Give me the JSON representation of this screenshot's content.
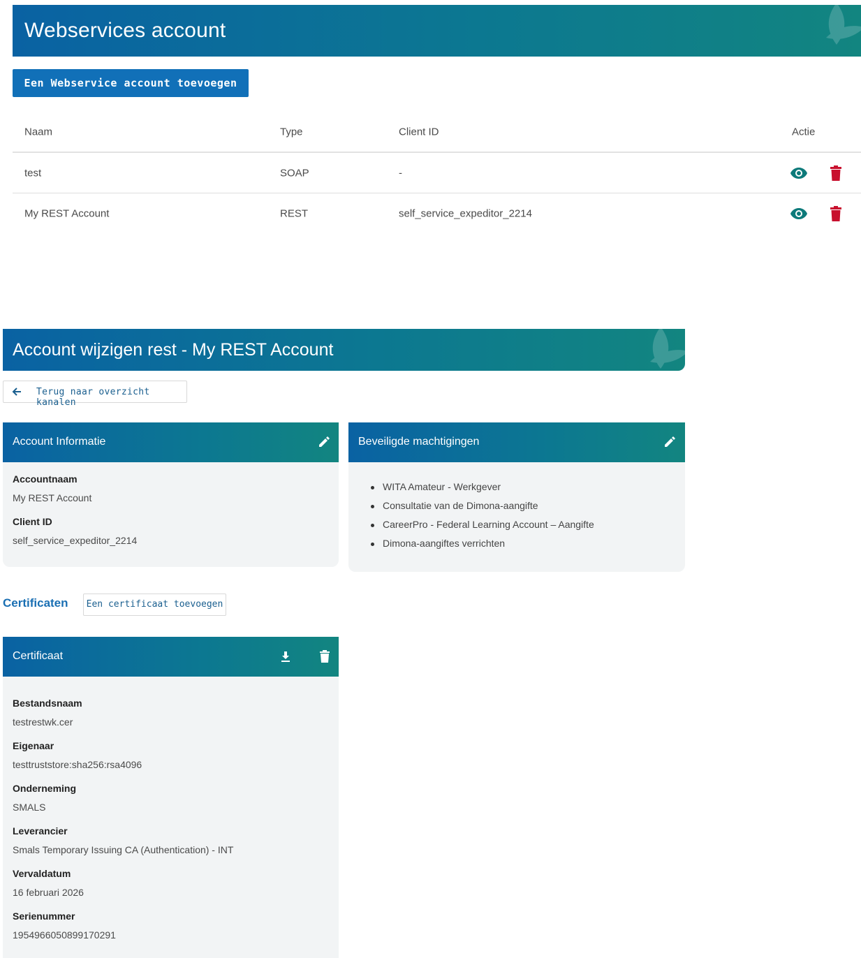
{
  "overview": {
    "title": "Webservices account",
    "add_button": "Een Webservice account toevoegen",
    "columns": {
      "naam": "Naam",
      "type": "Type",
      "client_id": "Client ID",
      "actie": "Actie"
    },
    "rows": [
      {
        "naam": "test",
        "type": "SOAP",
        "client_id": "-"
      },
      {
        "naam": "My REST Account",
        "type": "REST",
        "client_id": "self_service_expeditor_2214"
      }
    ],
    "icons": {
      "view": "eye-icon",
      "delete": "trash-icon"
    },
    "colors": {
      "view": "#0d7a7a",
      "delete": "#c8102e"
    }
  },
  "edit": {
    "title": "Account wijzigen rest - My REST Account",
    "back_button": "Terug naar overzicht kanalen",
    "account_info": {
      "title": "Account Informatie",
      "accountnaam_label": "Accountnaam",
      "accountnaam_value": "My REST Account",
      "client_id_label": "Client ID",
      "client_id_value": "self_service_expeditor_2214"
    },
    "permissions": {
      "title": "Beveiligde machtigingen",
      "items": [
        "WITA Amateur - Werkgever",
        "Consultatie van de Dimona-aangifte",
        "CareerPro - Federal Learning Account – Aangifte",
        "Dimona-aangiftes verrichten"
      ]
    },
    "certificates": {
      "section_title": "Certificaten",
      "add_button": "Een certificaat toevoegen",
      "card_title": "Certificaat",
      "fields": [
        {
          "label": "Bestandsnaam",
          "value": "testrestwk.cer"
        },
        {
          "label": "Eigenaar",
          "value": "testtruststore:sha256:rsa4096"
        },
        {
          "label": "Onderneming",
          "value": "SMALS"
        },
        {
          "label": "Leverancier",
          "value": "Smals Temporary Issuing CA (Authentication) - INT"
        },
        {
          "label": "Vervaldatum",
          "value": "16 februari 2026"
        },
        {
          "label": "Serienummer",
          "value": "1954966050899170291"
        }
      ]
    }
  },
  "brand_gradient": [
    "#0a62a3",
    "#0c7891",
    "#128580"
  ]
}
